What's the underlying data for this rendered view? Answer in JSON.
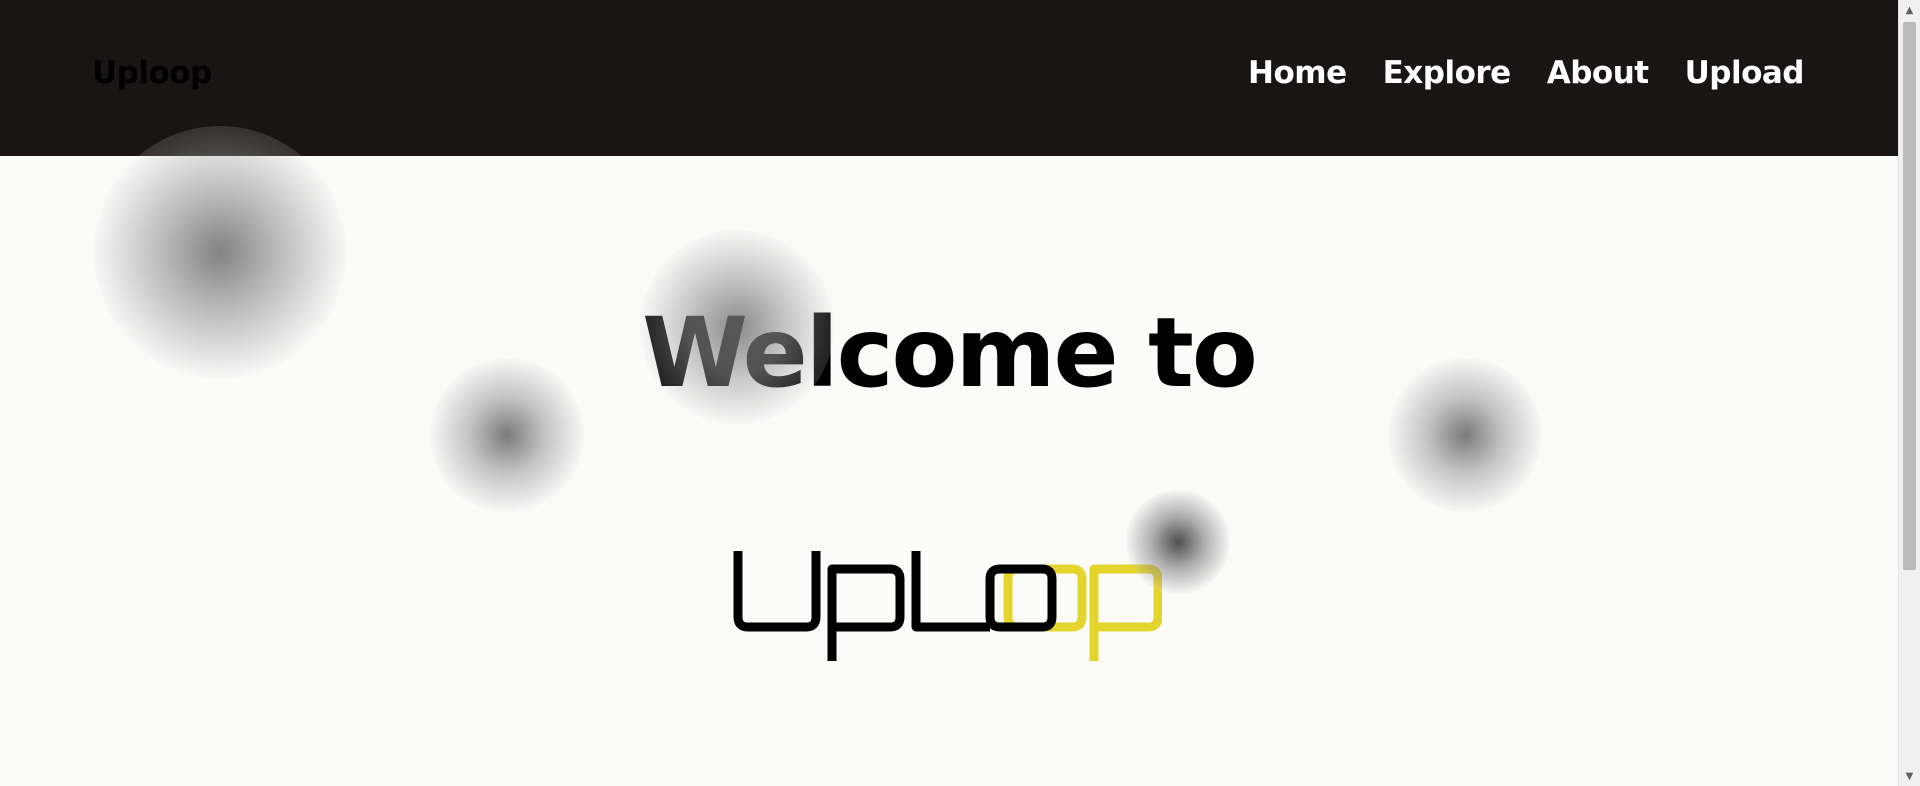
{
  "header": {
    "brand": "Uploop",
    "nav": [
      {
        "label": "Home"
      },
      {
        "label": "Explore"
      },
      {
        "label": "About"
      },
      {
        "label": "Upload"
      }
    ]
  },
  "hero": {
    "heading": "Welcome to",
    "logo_text": "UpLoop",
    "logo_primary_color": "#000000",
    "logo_accent_color": "#e4d52c"
  },
  "colors": {
    "header_background": "#1a1515",
    "page_background": "#fbfbfa"
  }
}
